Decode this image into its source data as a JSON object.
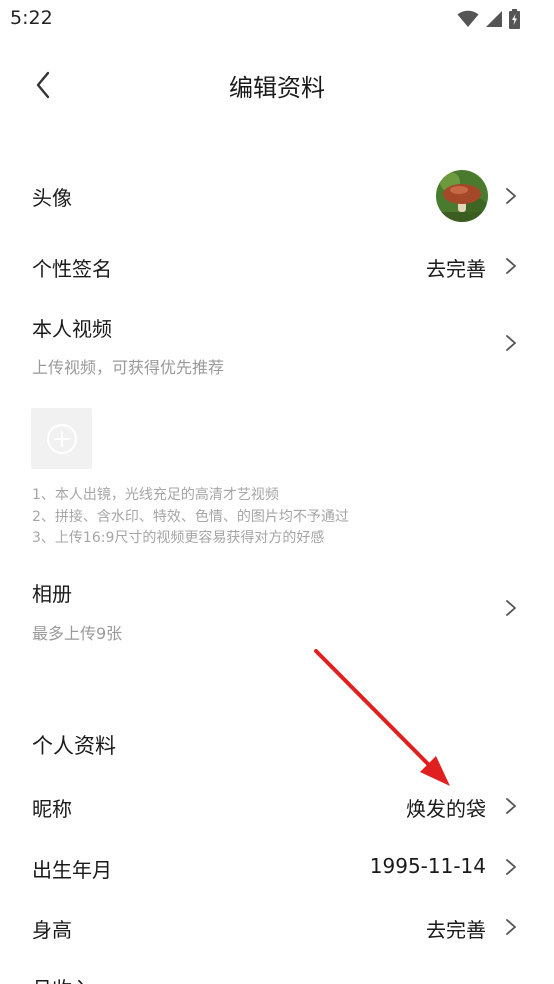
{
  "status_bar": {
    "time": "5:22",
    "icons": [
      "wifi-icon",
      "cellular-signal-icon",
      "battery-charging-icon"
    ]
  },
  "header": {
    "title": "编辑资料",
    "back_icon": "chevron-left-icon"
  },
  "rows": {
    "avatar": {
      "label": "头像"
    },
    "signature": {
      "label": "个性签名",
      "value": "去完善"
    },
    "video": {
      "label": "本人视频",
      "subtitle": "上传视频，可获得优先推荐"
    },
    "video_tips": [
      "1、本人出镜，光线充足的高清才艺视频",
      "2、拼接、含水印、特效、色情、的图片均不予通过",
      "3、上传16:9尺寸的视频更容易获得对方的好感"
    ],
    "album": {
      "label": "相册",
      "subtitle": "最多上传9张"
    }
  },
  "profile": {
    "heading": "个人资料",
    "nickname": {
      "label": "昵称",
      "value": "焕发的袋"
    },
    "birth": {
      "label": "出生年月",
      "value": "1995-11-14"
    },
    "height": {
      "label": "身高",
      "value": "去完善"
    },
    "income": {
      "label": "月收入"
    }
  },
  "colors": {
    "annotation_arrow": "#e0201f",
    "muted_text": "#9a9a9a",
    "add_box_bg": "#f1f1f1"
  }
}
